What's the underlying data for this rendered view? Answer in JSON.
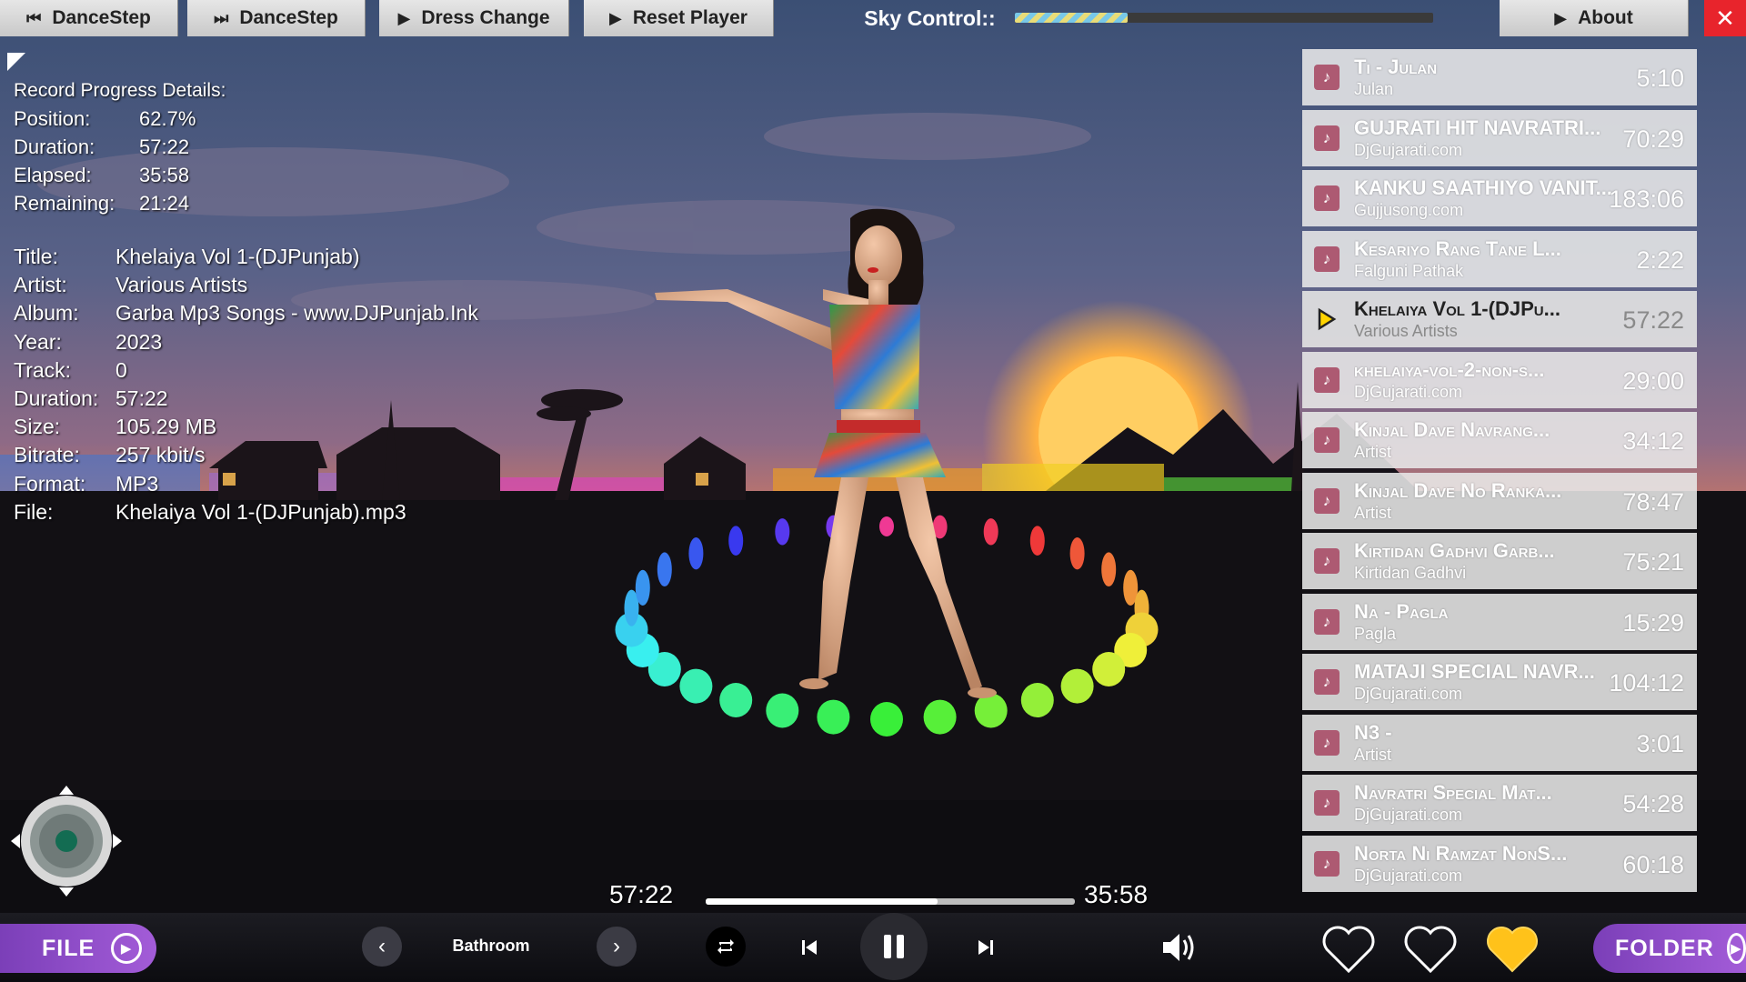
{
  "toolbar": {
    "dance_prev_label": "DanceStep",
    "dance_next_label": "DanceStep",
    "dress_label": "Dress Change",
    "reset_label": "Reset Player",
    "sky_label": "Sky Control::",
    "sky_level": 0.27,
    "about_label": "About",
    "close_label": "✕"
  },
  "record": {
    "heading": "Record Progress Details:",
    "position_key": "Position:",
    "position": "62.7%",
    "duration_key": "Duration:",
    "duration": "57:22",
    "elapsed_key": "Elapsed:",
    "elapsed": "35:58",
    "remaining_key": "Remaining:",
    "remaining": "21:24"
  },
  "meta": {
    "title_key": "Title:",
    "title": "Khelaiya Vol 1-(DJPunjab)",
    "artist_key": "Artist:",
    "artist": "Various Artists",
    "album_key": "Album:",
    "album": "Garba Mp3 Songs - www.DJPunjab.Ink",
    "year_key": "Year:",
    "year": "2023",
    "track_key": "Track:",
    "track": "0",
    "duration_key": "Duration:",
    "duration": "57:22",
    "size_key": "Size:",
    "size": "105.29 MB",
    "bitrate_key": "Bitrate:",
    "bitrate": "257 kbit/s",
    "format_key": "Format:",
    "format": "MP3",
    "file_key": "File:",
    "file": "Khelaiya Vol 1-(DJPunjab).mp3"
  },
  "playlist": [
    {
      "title": "Ti - Julan",
      "artist": "Julan",
      "duration": "5:10"
    },
    {
      "title": "GUJRATI HIT NAVRATRI...",
      "artist": "DjGujarati.com",
      "duration": "70:29"
    },
    {
      "title": "KANKU SAATHIYO VANIT...",
      "artist": "Gujjusong.com",
      "duration": "183:06"
    },
    {
      "title": "Kesariyo Rang Tane L...",
      "artist": "Falguni Pathak",
      "duration": "2:22"
    },
    {
      "title": "Khelaiya Vol 1-(DJPu...",
      "artist": "Various Artists",
      "duration": "57:22",
      "current": true
    },
    {
      "title": "khelaiya-vol-2-non-s...",
      "artist": "DjGujarati.com",
      "duration": "29:00"
    },
    {
      "title": "Kinjal Dave  Navrang...",
      "artist": "Artist",
      "duration": "34:12"
    },
    {
      "title": "Kinjal Dave No Ranka...",
      "artist": "Artist",
      "duration": "78:47"
    },
    {
      "title": "Kirtidan Gadhvi Garb...",
      "artist": "Kirtidan Gadhvi",
      "duration": "75:21"
    },
    {
      "title": "Na - Pagla",
      "artist": "Pagla",
      "duration": "15:29"
    },
    {
      "title": "MATAJI SPECIAL  NAVR...",
      "artist": "DjGujarati.com",
      "duration": "104:12"
    },
    {
      "title": "N3 -",
      "artist": "Artist",
      "duration": "3:01"
    },
    {
      "title": "Navratri Special Mat...",
      "artist": "DjGujarati.com",
      "duration": "54:28"
    },
    {
      "title": "Norta Ni Ramzat NonS...",
      "artist": "DjGujarati.com",
      "duration": "60:18"
    }
  ],
  "progress": {
    "total": "57:22",
    "elapsed": "35:58",
    "fraction": 0.627
  },
  "bottom": {
    "file_label": "FILE",
    "scene_name": "Bathroom",
    "folder_label": "FOLDER"
  },
  "colors": {
    "accent_purple": "#a35cd8",
    "close_red": "#e8242c",
    "heart_gold": "#ffc21a",
    "note_badge": "#ad5a72"
  },
  "icons": {
    "prev_scene": "chevron-left-icon",
    "next_scene": "chevron-right-icon",
    "repeat": "repeat-icon",
    "skip_back": "skip-back-icon",
    "pause": "pause-icon",
    "skip_forward": "skip-forward-icon",
    "volume": "volume-icon",
    "favorite": "heart-icon"
  }
}
